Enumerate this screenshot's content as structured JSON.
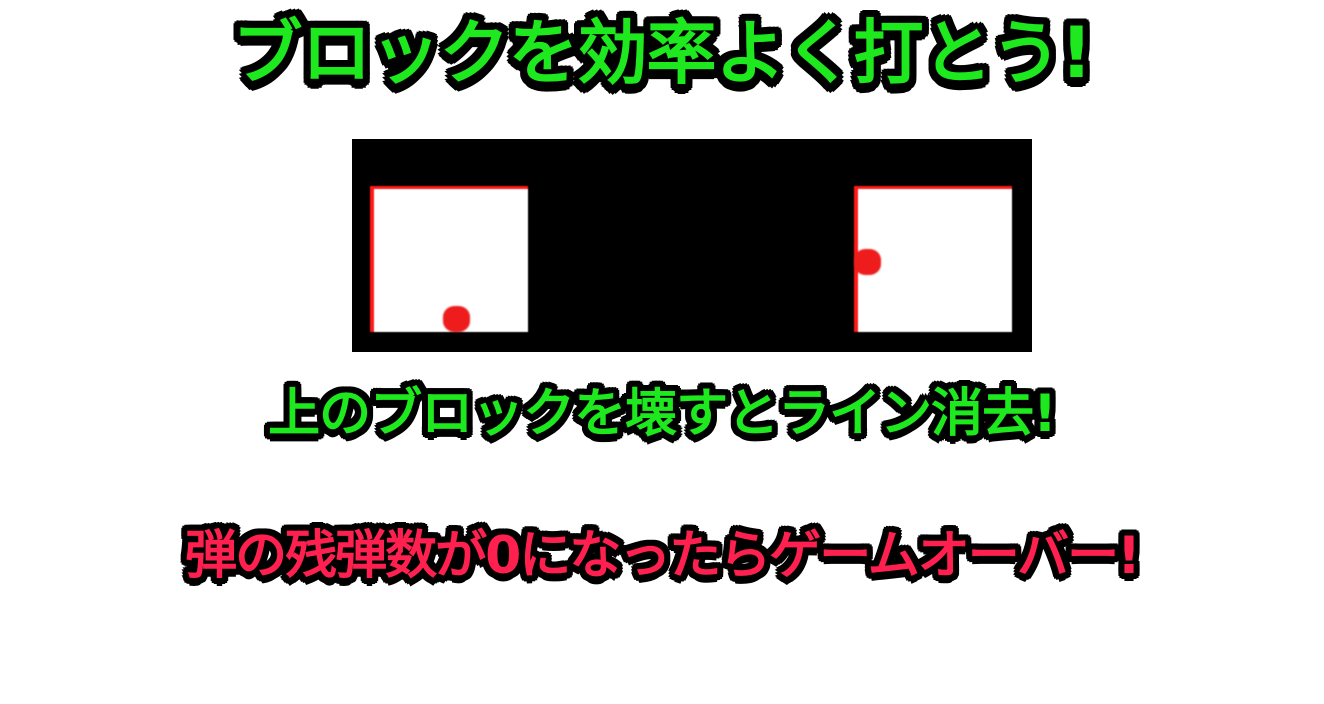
{
  "title": "ブロックを効率よく打とう!",
  "subtitle1": "上のブロックを壊すとライン消去!",
  "subtitle2": "弾の残弾数が0になったらゲームオーバー!",
  "colors": {
    "title_text": "#1ee81e",
    "warning_text": "#ff2050",
    "outline": "#000000",
    "panel_border": "#ff1a1a",
    "ball": "#ee1c1c",
    "demo_background": "#000000"
  }
}
